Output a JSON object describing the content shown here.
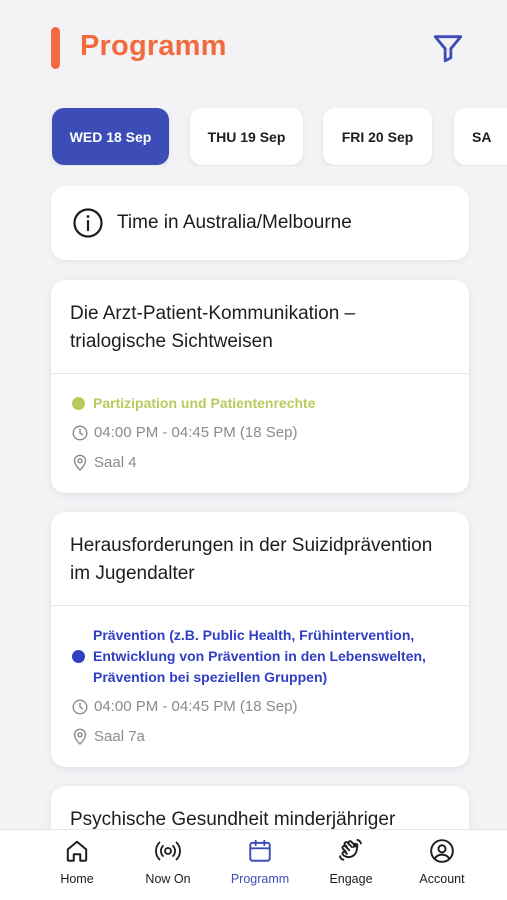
{
  "header": {
    "title": "Programm",
    "accent_color": "#f26a3d",
    "filter_icon": "filter-icon"
  },
  "date_tabs": [
    {
      "label": "WED 18 Sep",
      "active": true
    },
    {
      "label": "THU 19 Sep",
      "active": false
    },
    {
      "label": "FRI 20 Sep",
      "active": false
    },
    {
      "label": "SA",
      "active": false
    }
  ],
  "timezone": {
    "icon": "info-icon",
    "text": "Time in Australia/Melbourne"
  },
  "sessions": [
    {
      "title": "Die Arzt-Patient-Kommunikation – trialogische Sichtweisen",
      "topic": "Partizipation und Patientenrechte",
      "topic_color": "#b5cc5c",
      "time": "04:00 PM - 04:45 PM (18 Sep)",
      "room": "Saal 4"
    },
    {
      "title": "Herausforderungen in der Suizidprävention im Jugendalter",
      "topic": "Prävention (z.B. Public Health, Frühintervention, Entwicklung von Prävention in den Lebenswelten, Prävention bei speziellen Gruppen)",
      "topic_color": "#2f3fc4",
      "time": "04:00 PM - 04:45 PM (18 Sep)",
      "room": "Saal 7a"
    },
    {
      "title": "Psychische Gesundheit minderjähriger"
    }
  ],
  "bottom_nav": [
    {
      "label": "Home",
      "icon": "home-icon"
    },
    {
      "label": "Now On",
      "icon": "broadcast-icon"
    },
    {
      "label": "Programm",
      "icon": "calendar-icon",
      "active": true
    },
    {
      "label": "Engage",
      "icon": "waving-hand-icon"
    },
    {
      "label": "Account",
      "icon": "account-icon"
    }
  ],
  "colors": {
    "primary": "#3d4db7",
    "background": "#f3f3f6",
    "muted_text": "#8a8a92"
  }
}
